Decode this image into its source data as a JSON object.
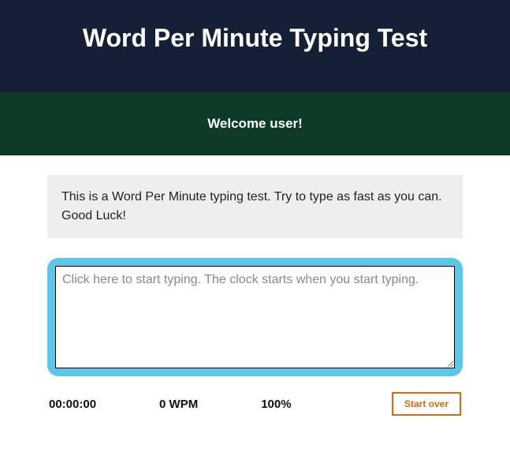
{
  "header": {
    "title": "Word Per Minute Typing Test"
  },
  "welcome": {
    "message": "Welcome user!"
  },
  "instructions": {
    "text": "This is a Word Per Minute typing test. Try to type as fast as you can. Good Luck!"
  },
  "typing": {
    "placeholder": "Click here to start typing. The clock starts when you start typing.",
    "value": ""
  },
  "stats": {
    "timer": "00:00:00",
    "wpm": "0 WPM",
    "accuracy": "100%"
  },
  "buttons": {
    "start_over": "Start over"
  }
}
